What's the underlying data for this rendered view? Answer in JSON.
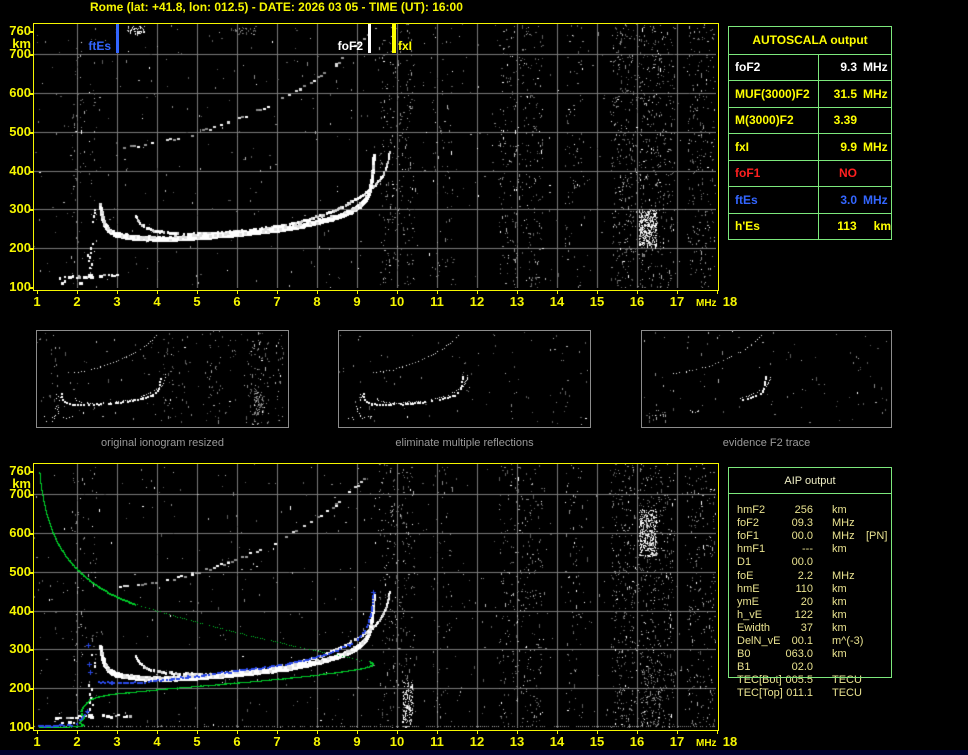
{
  "title": "Rome (lat: +41.8, lon: 012.5) - DATE: 2026 03 05 - TIME (UT): 16:00",
  "colors": {
    "axis": "#F6F600",
    "grid": "#7A7A7A",
    "blue_trace": "#2A49E8",
    "green_curve": "#00C828",
    "table_border": "#7CE87C",
    "white": "#FFFFFF",
    "yellow": "#FFFF00",
    "red": "#FF2020",
    "marker_blue": "#3366FF",
    "aip_text": "#E9E28F",
    "aip_header": "#F0EFC6",
    "caption": "#9A9A9A",
    "thumb_border": "#8C8C8C",
    "bottom_strip": "#000045"
  },
  "axes": {
    "x_ticks": [
      "1",
      "2",
      "3",
      "4",
      "5",
      "6",
      "7",
      "8",
      "9",
      "10",
      "11",
      "12",
      "13",
      "14",
      "15",
      "16",
      "17",
      "18"
    ],
    "x_unit": "MHz",
    "y_labels": [
      [
        "760",
        760
      ],
      [
        "km",
        727
      ],
      [
        "700",
        700
      ],
      [
        "600",
        600
      ],
      [
        "500",
        500
      ],
      [
        "400",
        400
      ],
      [
        "300",
        300
      ],
      [
        "200",
        200
      ],
      [
        "100",
        100
      ]
    ]
  },
  "markers": [
    {
      "label": "ftEs",
      "mhz": 3.0,
      "color": "#3366FF",
      "side": "left",
      "w": 3
    },
    {
      "label": "foF2",
      "mhz": 9.3,
      "color": "#FFFFFF",
      "side": "left",
      "w": 3
    },
    {
      "label": "fxI",
      "mhz": 9.9,
      "color": "#FFFF00",
      "side": "right",
      "w": 4
    }
  ],
  "autoscala": {
    "header": "AUTOSCALA output",
    "rows": [
      {
        "label": "foF2",
        "value": "9.3",
        "unit": "MHz",
        "color": "#FFFFFF",
        "pad": 0
      },
      {
        "label": "MUF(3000)F2",
        "value": "31.5",
        "unit": "MHz",
        "color": "#FFFF00",
        "pad": 0
      },
      {
        "label": "M(3000)F2",
        "value": "3.39",
        "unit": "",
        "color": "#FFFF00",
        "pad": 0
      },
      {
        "label": "fxI",
        "value": "9.9",
        "unit": "MHz",
        "color": "#FFFF00",
        "pad": 0
      },
      {
        "label": "foF1",
        "value": "NO",
        "unit": "",
        "color": "#FF2020",
        "pad": 0
      },
      {
        "label": "ftEs",
        "value": "3.0",
        "unit": "MHz",
        "color": "#3366FF",
        "pad": 0
      },
      {
        "label": "h'Es",
        "value": "113",
        "unit": "km",
        "color": "#FFFF00",
        "pad": 12
      }
    ]
  },
  "aip": {
    "header": "AIP output",
    "rows": [
      [
        "hmF2",
        "256",
        "km",
        ""
      ],
      [
        "foF2",
        "09.3",
        "MHz",
        ""
      ],
      [
        "foF1",
        "00.0",
        "MHz",
        "[PN]"
      ],
      [
        "hmF1",
        "---",
        "km",
        ""
      ],
      [
        "D1",
        "00.0",
        "",
        ""
      ],
      [
        "foE",
        "2.2",
        "MHz",
        ""
      ],
      [
        "hmE",
        "110",
        "km",
        ""
      ],
      [
        "ymE",
        "20",
        "km",
        ""
      ],
      [
        "h_vE",
        "122",
        "km",
        ""
      ],
      [
        "Ewidth",
        "37",
        "km",
        ""
      ],
      [
        "DelN_vE",
        "00.1",
        "m^(-3)",
        ""
      ],
      [
        "B0",
        "063.0",
        "km",
        ""
      ],
      [
        "B1",
        "02.0",
        "",
        ""
      ],
      [
        "TEC[Bot]",
        "005.5",
        "TECU",
        ""
      ],
      [
        "TEC[Top]",
        "011.1",
        "TECU",
        ""
      ]
    ]
  },
  "thumbnails": [
    {
      "caption": "original ionogram resized"
    },
    {
      "caption": "eliminate multiple reflections"
    },
    {
      "caption": "evidence F2 trace"
    }
  ],
  "ionogram": {
    "x_range": [
      1,
      18
    ],
    "y_range_km": [
      100,
      760
    ],
    "traces": {
      "o_mode": [
        [
          2.56,
          312
        ],
        [
          2.6,
          288
        ],
        [
          2.66,
          268
        ],
        [
          2.76,
          252
        ],
        [
          2.92,
          242
        ],
        [
          3.15,
          236
        ],
        [
          3.5,
          232
        ],
        [
          3.9,
          230
        ],
        [
          4.3,
          230
        ],
        [
          4.8,
          232
        ],
        [
          5.3,
          236
        ],
        [
          5.8,
          240
        ],
        [
          6.3,
          245
        ],
        [
          6.8,
          251
        ],
        [
          7.3,
          258
        ],
        [
          7.8,
          268
        ],
        [
          8.2,
          278
        ],
        [
          8.55,
          289
        ],
        [
          8.85,
          302
        ],
        [
          9.05,
          316
        ],
        [
          9.2,
          332
        ],
        [
          9.28,
          352
        ],
        [
          9.33,
          375
        ],
        [
          9.36,
          400
        ],
        [
          9.38,
          425
        ],
        [
          9.39,
          442
        ]
      ],
      "x_mode": [
        [
          3.44,
          286
        ],
        [
          3.52,
          272
        ],
        [
          3.64,
          260
        ],
        [
          3.82,
          251
        ],
        [
          4.05,
          246
        ],
        [
          4.35,
          242
        ],
        [
          4.7,
          240
        ],
        [
          5.1,
          240
        ],
        [
          5.5,
          242
        ],
        [
          5.95,
          246
        ],
        [
          6.4,
          251
        ],
        [
          6.85,
          257
        ],
        [
          7.3,
          265
        ],
        [
          7.7,
          275
        ],
        [
          8.1,
          288
        ],
        [
          8.45,
          302
        ],
        [
          8.75,
          317
        ],
        [
          9.0,
          332
        ],
        [
          9.25,
          349
        ],
        [
          9.45,
          367
        ],
        [
          9.6,
          387
        ],
        [
          9.7,
          408
        ],
        [
          9.76,
          430
        ],
        [
          9.79,
          452
        ]
      ],
      "second_hop": [
        [
          3.05,
          462
        ],
        [
          3.5,
          467
        ],
        [
          3.95,
          474
        ],
        [
          4.4,
          484
        ],
        [
          4.85,
          496
        ],
        [
          5.3,
          510
        ],
        [
          5.75,
          526
        ],
        [
          6.2,
          544
        ],
        [
          6.65,
          564
        ],
        [
          7.1,
          587
        ],
        [
          7.55,
          613
        ],
        [
          8.0,
          642
        ],
        [
          8.45,
          676
        ],
        [
          8.85,
          712
        ],
        [
          9.15,
          744
        ]
      ],
      "es_rows": [
        [
          1.45,
          2.28,
          127
        ],
        [
          2.55,
          3.05,
          130
        ],
        [
          3.15,
          3.4,
          128
        ],
        [
          1.6,
          2.12,
          112
        ]
      ],
      "es_verticals": [
        [
          2.33,
          140,
          216
        ],
        [
          2.4,
          258,
          305
        ]
      ],
      "green_solid1": [
        [
          1.06,
          758
        ],
        [
          1.1,
          720
        ],
        [
          1.16,
          684
        ],
        [
          1.24,
          650
        ],
        [
          1.33,
          620
        ],
        [
          1.44,
          592
        ],
        [
          1.57,
          566
        ],
        [
          1.72,
          542
        ],
        [
          1.9,
          519
        ],
        [
          2.1,
          498
        ],
        [
          2.33,
          478
        ],
        [
          2.58,
          460
        ],
        [
          2.85,
          444
        ],
        [
          3.15,
          430
        ],
        [
          3.45,
          418
        ]
      ],
      "green_dotted": [
        [
          3.45,
          418
        ],
        [
          3.9,
          403
        ],
        [
          4.4,
          388
        ],
        [
          4.9,
          374
        ],
        [
          5.4,
          360
        ],
        [
          5.9,
          347
        ],
        [
          6.4,
          334
        ],
        [
          6.9,
          322
        ],
        [
          7.4,
          310
        ],
        [
          7.9,
          299
        ],
        [
          8.35,
          290
        ],
        [
          8.75,
          281
        ],
        [
          9.1,
          274
        ],
        [
          9.3,
          269
        ]
      ],
      "green_solid2": [
        [
          9.3,
          269
        ],
        [
          9.38,
          264
        ],
        [
          9.35,
          258
        ],
        [
          9.1,
          251
        ],
        [
          8.6,
          243
        ],
        [
          8.0,
          235
        ],
        [
          7.3,
          227
        ],
        [
          6.5,
          219
        ],
        [
          5.7,
          212
        ],
        [
          4.9,
          205
        ],
        [
          4.2,
          199
        ],
        [
          3.6,
          193
        ],
        [
          3.1,
          188
        ],
        [
          2.7,
          183
        ],
        [
          2.45,
          177
        ],
        [
          2.3,
          170
        ],
        [
          2.2,
          160
        ],
        [
          2.12,
          150
        ],
        [
          2.08,
          140
        ],
        [
          2.11,
          132
        ],
        [
          2.16,
          126
        ],
        [
          2.1,
          118
        ],
        [
          2.04,
          112
        ],
        [
          2.1,
          108
        ],
        [
          2.16,
          105
        ],
        [
          2.0,
          102
        ],
        [
          1.7,
          101
        ],
        [
          1.4,
          100.5
        ],
        [
          1.05,
          100.5
        ]
      ],
      "blue_f": [
        [
          2.52,
          219
        ],
        [
          2.85,
          216
        ],
        [
          3.2,
          215
        ],
        [
          3.55,
          217
        ],
        [
          3.95,
          221
        ],
        [
          4.35,
          226
        ],
        [
          4.75,
          231
        ],
        [
          5.15,
          236
        ],
        [
          5.55,
          241
        ],
        [
          5.95,
          246
        ],
        [
          6.4,
          252
        ],
        [
          6.85,
          259
        ],
        [
          7.3,
          267
        ],
        [
          7.75,
          277
        ],
        [
          8.15,
          288
        ],
        [
          8.5,
          300
        ],
        [
          8.8,
          314
        ],
        [
          9.0,
          329
        ],
        [
          9.15,
          346
        ],
        [
          9.25,
          366
        ],
        [
          9.32,
          389
        ],
        [
          9.36,
          412
        ],
        [
          9.38,
          433
        ],
        [
          9.39,
          448
        ]
      ],
      "blue_es": [
        [
          1.02,
          104
        ],
        [
          1.4,
          105
        ],
        [
          1.8,
          107
        ],
        [
          1.98,
          109
        ]
      ],
      "blue_es_jog": [
        [
          2.02,
          114
        ],
        [
          2.1,
          124
        ],
        [
          2.17,
          134
        ],
        [
          2.22,
          141
        ]
      ],
      "blue_plus": [
        [
          2.27,
          312
        ],
        [
          2.31,
          262
        ],
        [
          2.33,
          242
        ],
        [
          2.24,
          140
        ],
        [
          9.4,
          449
        ]
      ]
    },
    "noise": {
      "uniform": 0.0028,
      "bands": [
        [
          1.85,
          2.2,
          0.016
        ],
        [
          2.3,
          2.5,
          0.013
        ],
        [
          9.55,
          10.45,
          0.028
        ],
        [
          10.9,
          11.4,
          0.013
        ],
        [
          12.55,
          13.65,
          0.026
        ],
        [
          14.2,
          14.65,
          0.016
        ],
        [
          15.35,
          16.95,
          0.042
        ],
        [
          17.25,
          17.95,
          0.032
        ]
      ],
      "clusters_top": [
        [
          16.05,
          16.5,
          205,
          300,
          0.45,
          1
        ],
        [
          3.25,
          3.7,
          752,
          772,
          0.3,
          1
        ],
        [
          5.85,
          6.5,
          750,
          770,
          0.15,
          0
        ]
      ],
      "clusters_bottom": [
        [
          16.05,
          16.5,
          540,
          660,
          0.35,
          1
        ],
        [
          10.15,
          10.4,
          100,
          215,
          0.3,
          1
        ],
        [
          16.1,
          16.6,
          100,
          250,
          0.08,
          0
        ]
      ]
    }
  }
}
